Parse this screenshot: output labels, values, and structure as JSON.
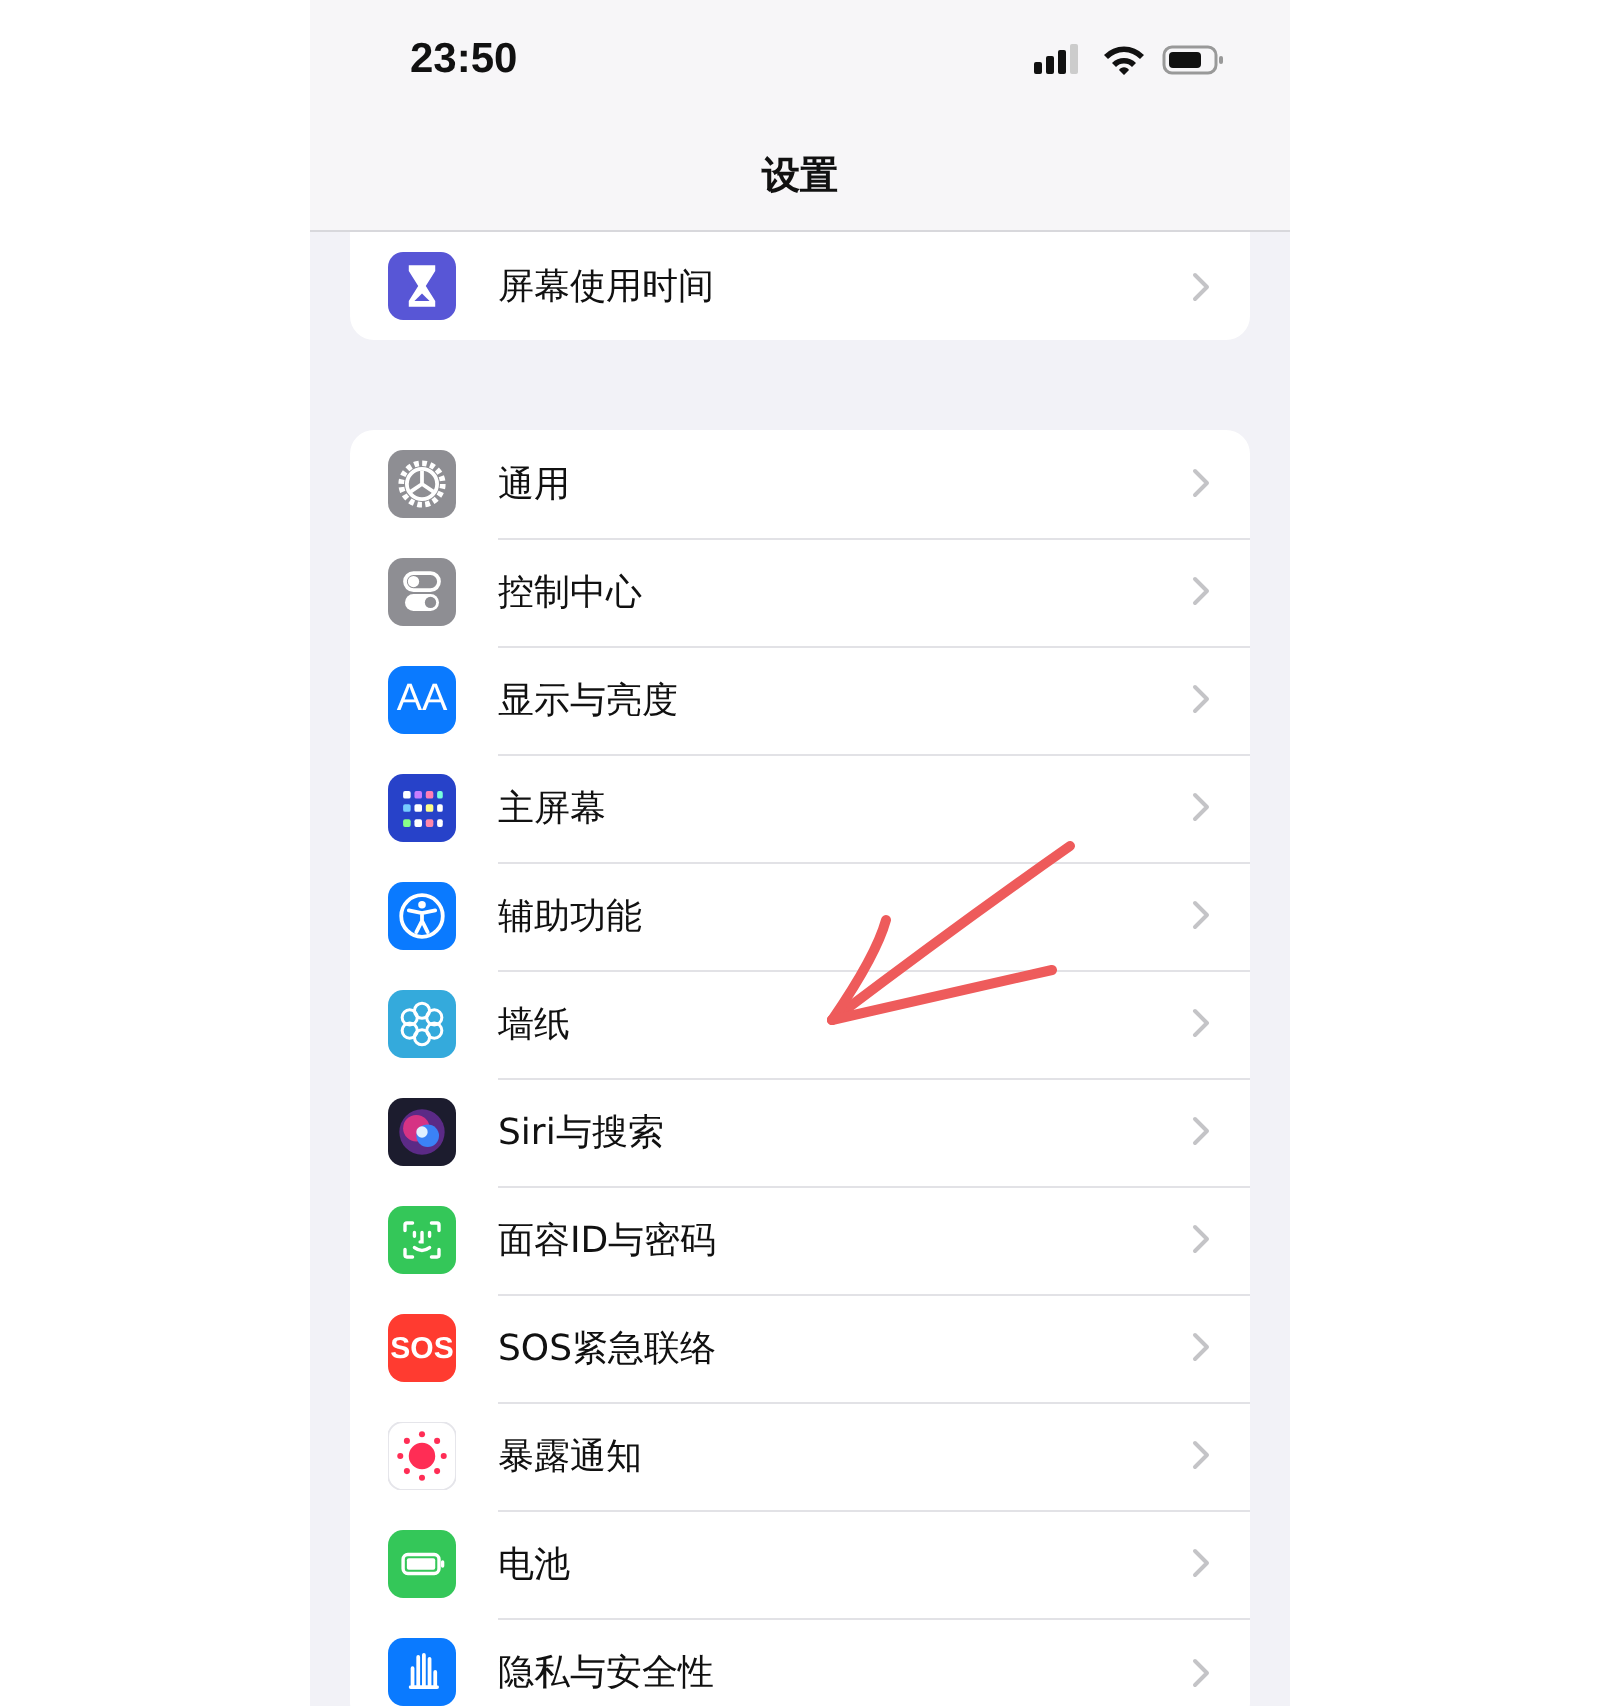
{
  "status_bar": {
    "time": "23:50"
  },
  "nav": {
    "title": "设置"
  },
  "groups": [
    {
      "items": [
        {
          "label": "屏幕使用时间",
          "kind": "hourglass"
        }
      ]
    },
    {
      "items": [
        {
          "label": "通用",
          "kind": "gear"
        },
        {
          "label": "控制中心",
          "kind": "toggles"
        },
        {
          "label": "显示与亮度",
          "kind": "text",
          "icon_label": "AA"
        },
        {
          "label": "主屏幕",
          "kind": "grid"
        },
        {
          "label": "辅助功能",
          "kind": "figure"
        },
        {
          "label": "墙纸",
          "kind": "flower"
        },
        {
          "label": "Siri与搜索",
          "kind": "orb"
        },
        {
          "label": "面容ID与密码",
          "kind": "face"
        },
        {
          "label": "SOS紧急联络",
          "kind": "text",
          "icon_label": "SOS"
        },
        {
          "label": "暴露通知",
          "kind": "sun"
        },
        {
          "label": "电池",
          "kind": "battery"
        },
        {
          "label": "隐私与安全性",
          "kind": "hand"
        }
      ]
    }
  ],
  "annotation": {
    "kind": "arrow"
  }
}
